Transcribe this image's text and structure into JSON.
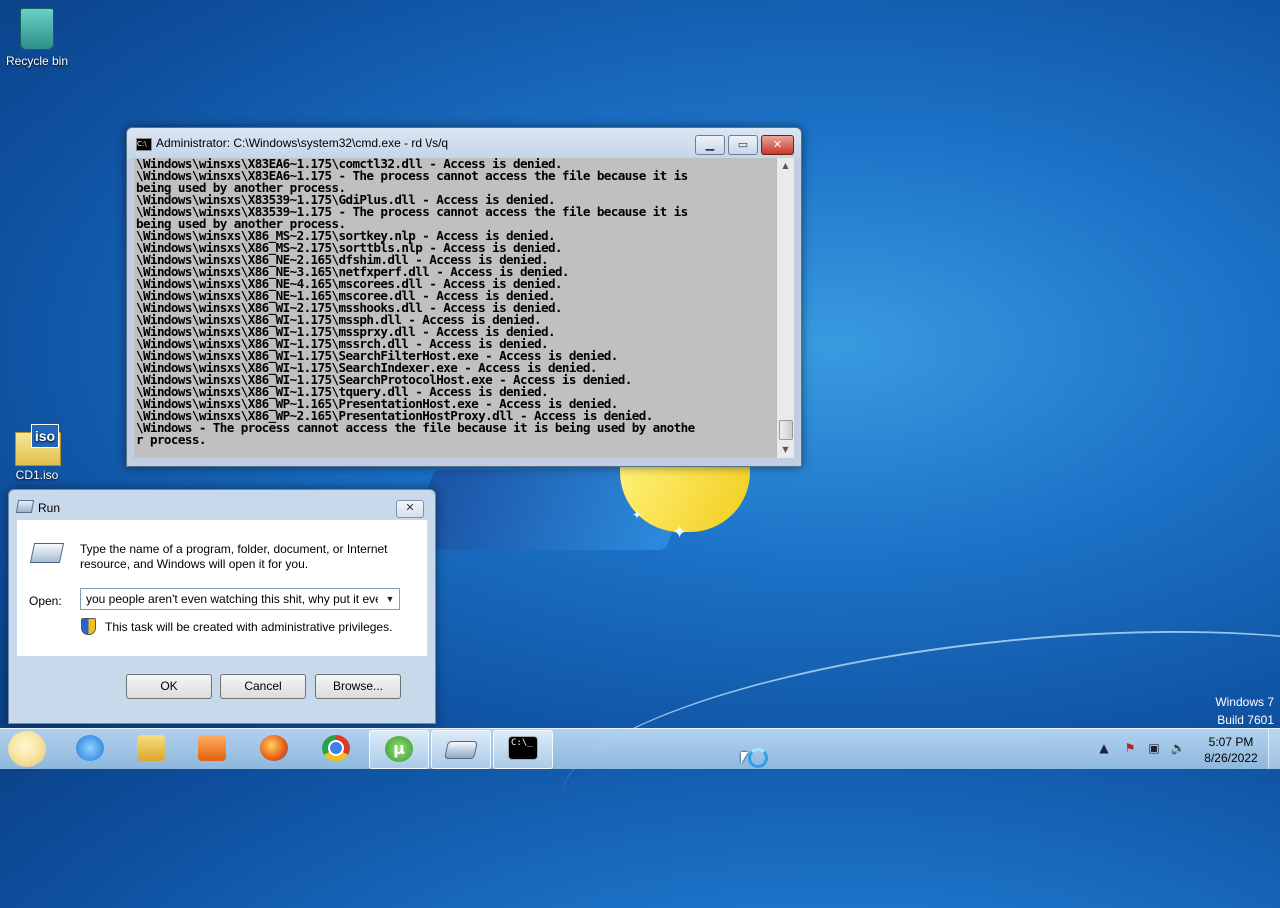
{
  "desktop": {
    "icons": [
      {
        "label": "Recycle bin"
      },
      {
        "label": "CD1.iso",
        "tag": "iso"
      }
    ],
    "watermark": {
      "line1": "Windows 7",
      "line2": "Build 7601"
    }
  },
  "cmd": {
    "title": "Administrator: C:\\Windows\\system32\\cmd.exe - rd \\/s/q",
    "lines": [
      "\\Windows\\winsxs\\X83EA6~1.175\\comctl32.dll - Access is denied.",
      "\\Windows\\winsxs\\X83EA6~1.175 - The process cannot access the file because it is",
      "being used by another process.",
      "\\Windows\\winsxs\\X83539~1.175\\GdiPlus.dll - Access is denied.",
      "\\Windows\\winsxs\\X83539~1.175 - The process cannot access the file because it is",
      "being used by another process.",
      "\\Windows\\winsxs\\X86_MS~2.175\\sortkey.nlp - Access is denied.",
      "\\Windows\\winsxs\\X86_MS~2.175\\sorttbls.nlp - Access is denied.",
      "\\Windows\\winsxs\\X86_NE~2.165\\dfshim.dll - Access is denied.",
      "\\Windows\\winsxs\\X86_NE~3.165\\netfxperf.dll - Access is denied.",
      "\\Windows\\winsxs\\X86_NE~4.165\\mscorees.dll - Access is denied.",
      "\\Windows\\winsxs\\X86_NE~1.165\\mscoree.dll - Access is denied.",
      "\\Windows\\winsxs\\X86_WI~2.175\\msshooks.dll - Access is denied.",
      "\\Windows\\winsxs\\X86_WI~1.175\\mssph.dll - Access is denied.",
      "\\Windows\\winsxs\\X86_WI~1.175\\mssprxy.dll - Access is denied.",
      "\\Windows\\winsxs\\X86_WI~1.175\\mssrch.dll - Access is denied.",
      "\\Windows\\winsxs\\X86_WI~1.175\\SearchFilterHost.exe - Access is denied.",
      "\\Windows\\winsxs\\X86_WI~1.175\\SearchIndexer.exe - Access is denied.",
      "\\Windows\\winsxs\\X86_WI~1.175\\SearchProtocolHost.exe - Access is denied.",
      "\\Windows\\winsxs\\X86_WI~1.175\\tquery.dll - Access is denied.",
      "\\Windows\\winsxs\\X86_WP~1.165\\PresentationHost.exe - Access is denied.",
      "\\Windows\\winsxs\\X86_WP~2.165\\PresentationHostProxy.dll - Access is denied.",
      "\\Windows - The process cannot access the file because it is being used by anothe",
      "r process."
    ]
  },
  "run": {
    "title": "Run",
    "description": "Type the name of a program, folder, document, or Internet resource, and Windows will open it for you.",
    "open_label": "Open:",
    "open_value": "you people aren't even watching this shit, why put it eve",
    "admin_note": "This task will be created with administrative privileges.",
    "ok_label": "OK",
    "cancel_label": "Cancel",
    "browse_label": "Browse..."
  },
  "taskbar": {
    "items": [
      {
        "icon": "internet-explorer-icon"
      },
      {
        "icon": "windows-explorer-icon"
      },
      {
        "icon": "media-player-icon"
      },
      {
        "icon": "firefox-icon"
      },
      {
        "icon": "chrome-icon"
      },
      {
        "icon": "utorrent-icon"
      },
      {
        "icon": "run-icon"
      },
      {
        "icon": "cmd-icon"
      }
    ],
    "clock": {
      "time": "5:07 PM",
      "date": "8/26/2022"
    }
  }
}
